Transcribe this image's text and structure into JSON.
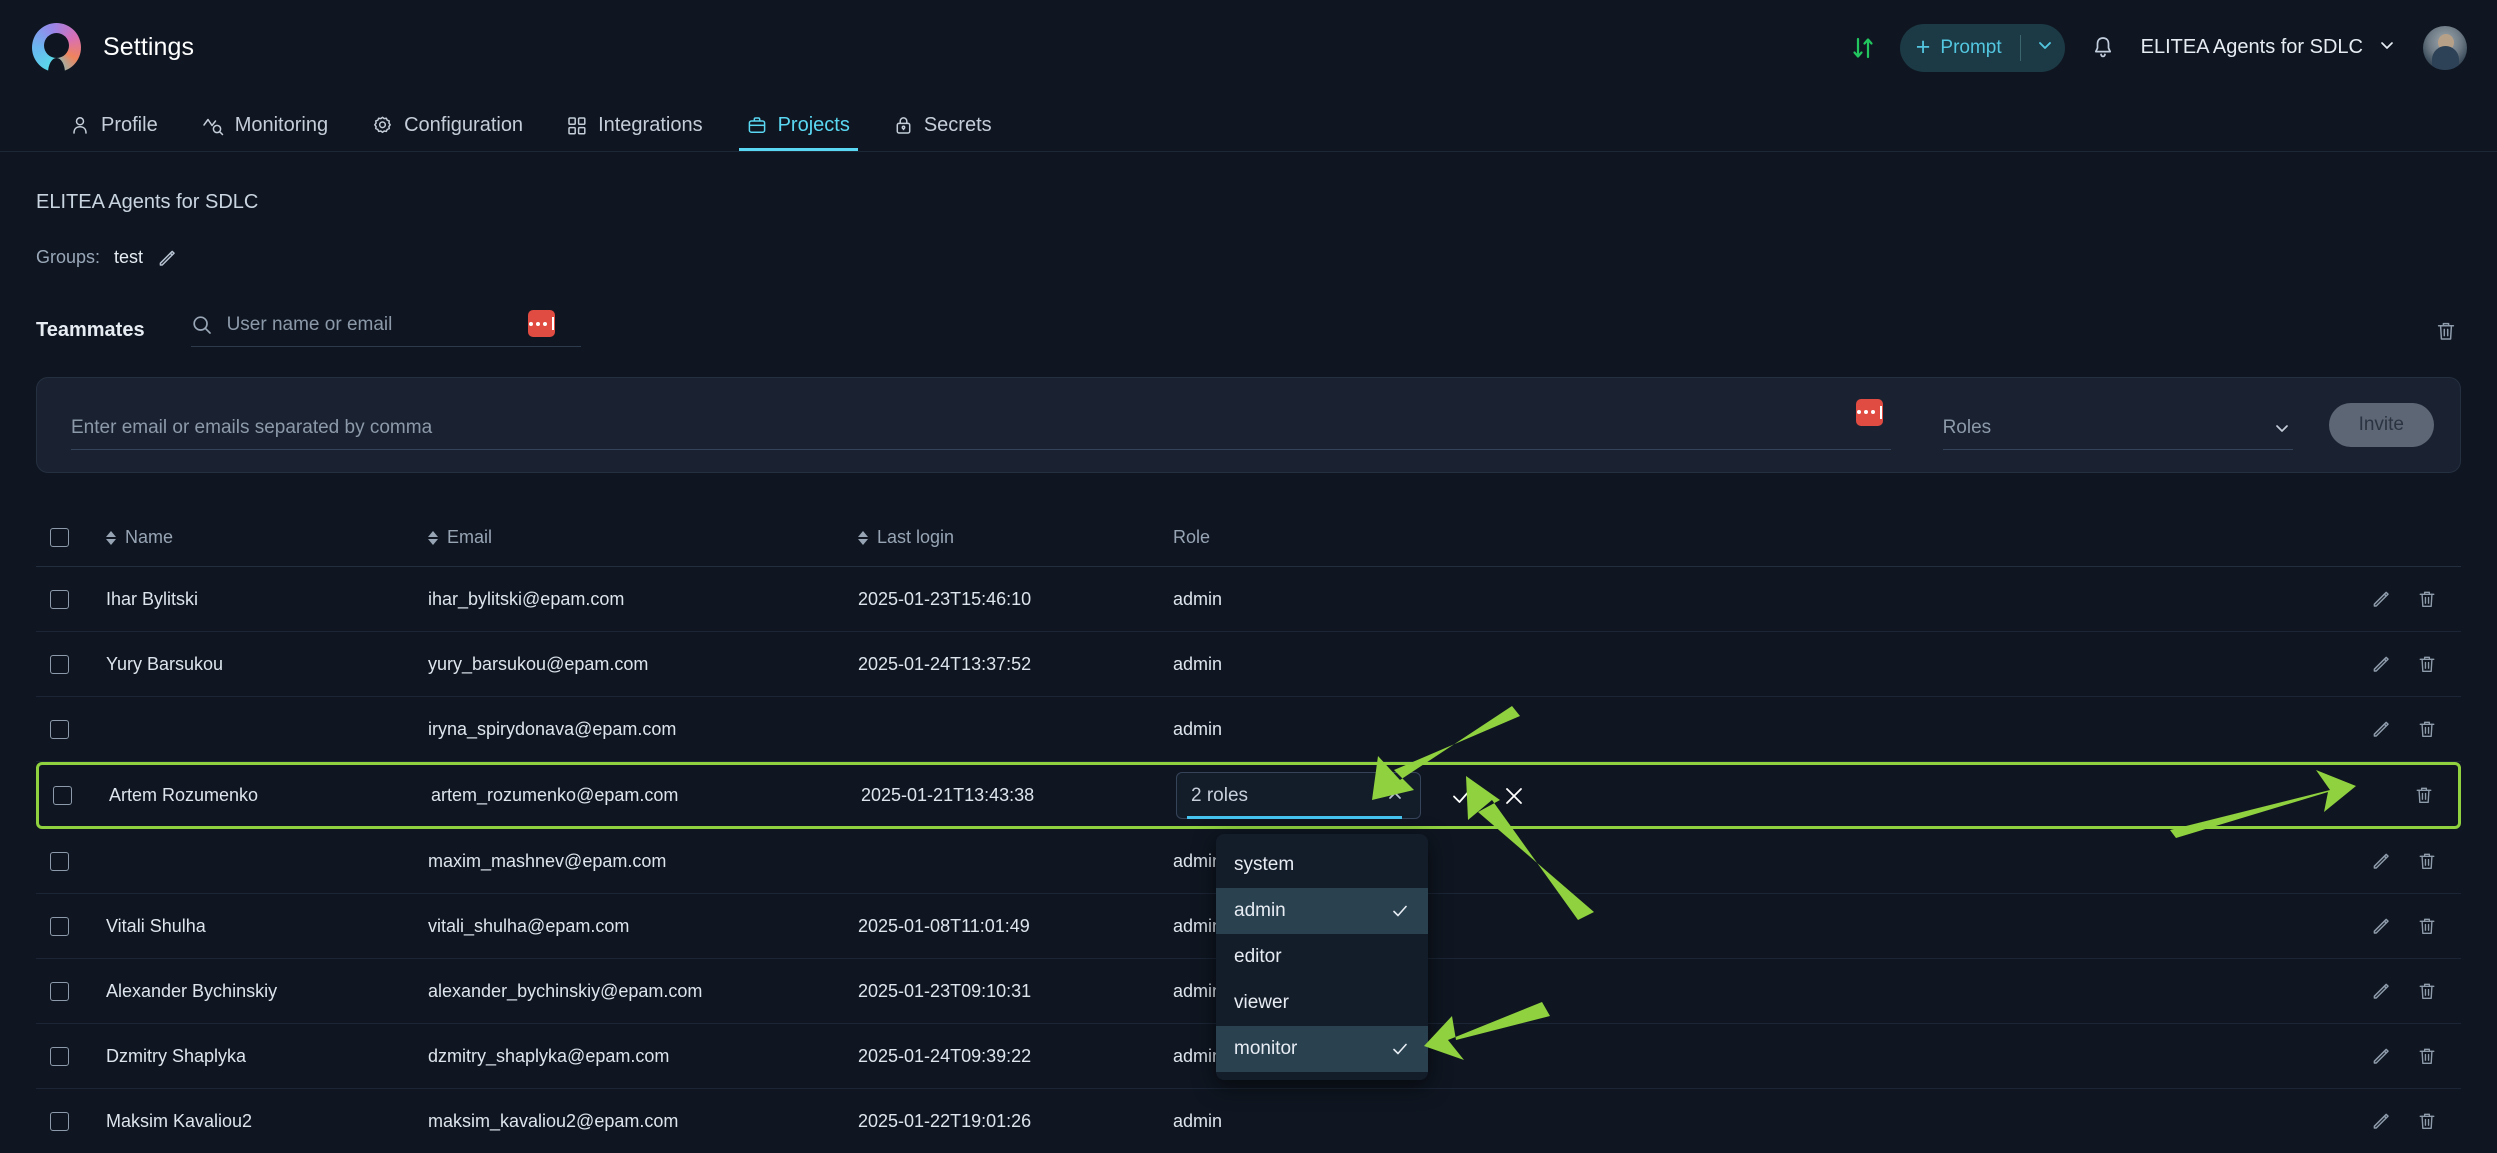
{
  "header": {
    "app_title": "Settings",
    "logo_icon": "elitea-logo-icon",
    "swap_icon": "swap-vertical-icon",
    "prompt_label": "Prompt",
    "prompt_plus_icon": "plus-icon",
    "prompt_chevron_icon": "chevron-down-icon",
    "bell_icon": "bell-icon",
    "project_selector_label": "ELITEA Agents for SDLC",
    "project_chevron_icon": "chevron-down-icon",
    "avatar_icon": "user-avatar"
  },
  "tabs": [
    {
      "label": "Profile",
      "icon": "user-icon",
      "active": false
    },
    {
      "label": "Monitoring",
      "icon": "monitoring-icon",
      "active": false
    },
    {
      "label": "Configuration",
      "icon": "gear-icon",
      "active": false
    },
    {
      "label": "Integrations",
      "icon": "grid-icon",
      "active": false
    },
    {
      "label": "Projects",
      "icon": "briefcase-icon",
      "active": true
    },
    {
      "label": "Secrets",
      "icon": "lock-icon",
      "active": false
    }
  ],
  "page": {
    "title": "ELITEA Agents for SDLC",
    "groups_label": "Groups:",
    "groups_value": "test",
    "edit_groups_icon": "pencil-icon"
  },
  "teammates": {
    "section_label": "Teammates",
    "search_placeholder": "User name or email",
    "search_value": "",
    "search_icon": "search-icon",
    "overflow_badge_icon": "three-dots-badge",
    "delete_all_icon": "trash-icon"
  },
  "invite": {
    "email_placeholder": "Enter email or emails separated by comma",
    "email_value": "",
    "roles_placeholder": "Roles",
    "roles_value": "",
    "roles_chevron_icon": "chevron-down-icon",
    "invite_label": "Invite",
    "overflow_badge_icon": "three-dots-badge"
  },
  "table": {
    "columns": [
      {
        "key": "check",
        "label": "",
        "sortable": false
      },
      {
        "key": "name",
        "label": "Name",
        "sortable": true
      },
      {
        "key": "email",
        "label": "Email",
        "sortable": true
      },
      {
        "key": "last_login",
        "label": "Last login",
        "sortable": true
      },
      {
        "key": "role",
        "label": "Role",
        "sortable": false
      },
      {
        "key": "actions",
        "label": "",
        "sortable": false
      }
    ],
    "sort_icon": "sort-arrows-icon",
    "edit_icon": "pencil-icon",
    "delete_icon": "trash-icon",
    "rows": [
      {
        "name": "Ihar Bylitski",
        "email": "ihar_bylitski@epam.com",
        "last_login": "2025-01-23T15:46:10",
        "role": "admin",
        "editing": false
      },
      {
        "name": "Yury Barsukou",
        "email": "yury_barsukou@epam.com",
        "last_login": "2025-01-24T13:37:52",
        "role": "admin",
        "editing": false
      },
      {
        "name": "",
        "email": "iryna_spirydonava@epam.com",
        "last_login": "",
        "role": "admin",
        "editing": false
      },
      {
        "name": "Artem Rozumenko",
        "email": "artem_rozumenko@epam.com",
        "last_login": "2025-01-21T13:43:38",
        "role": "2 roles",
        "editing": true
      },
      {
        "name": "",
        "email": "maxim_mashnev@epam.com",
        "last_login": "",
        "role": "admin",
        "editing": false
      },
      {
        "name": "Vitali Shulha",
        "email": "vitali_shulha@epam.com",
        "last_login": "2025-01-08T11:01:49",
        "role": "admin",
        "editing": false
      },
      {
        "name": "Alexander Bychinskiy",
        "email": "alexander_bychinskiy@epam.com",
        "last_login": "2025-01-23T09:10:31",
        "role": "admin",
        "editing": false
      },
      {
        "name": "Dzmitry Shaplyka",
        "email": "dzmitry_shaplyka@epam.com",
        "last_login": "2025-01-24T09:39:22",
        "role": "admin",
        "editing": false
      },
      {
        "name": "Maksim Kavaliou2",
        "email": "maksim_kavaliou2@epam.com",
        "last_login": "2025-01-22T19:01:26",
        "role": "admin",
        "editing": false
      }
    ]
  },
  "role_editor": {
    "selected_text": "2 roles",
    "chevron_up_icon": "chevron-up-icon",
    "confirm_icon": "check-icon",
    "cancel_icon": "close-icon",
    "options": [
      {
        "label": "system",
        "selected": false
      },
      {
        "label": "admin",
        "selected": true
      },
      {
        "label": "editor",
        "selected": false
      },
      {
        "label": "viewer",
        "selected": false
      },
      {
        "label": "monitor",
        "selected": true
      }
    ],
    "check_icon": "check-icon"
  },
  "annotations": {
    "highlight_color": "#8fd13f",
    "arrow_count": 3
  },
  "colors": {
    "background": "#0f1621",
    "card": "#1a2231",
    "accent_cyan": "#5ad7f2",
    "accent_green": "#22c55e",
    "badge_red": "#e04b42",
    "highlight_green": "#8fd13f",
    "dropdown_selected": "#2a4150"
  }
}
